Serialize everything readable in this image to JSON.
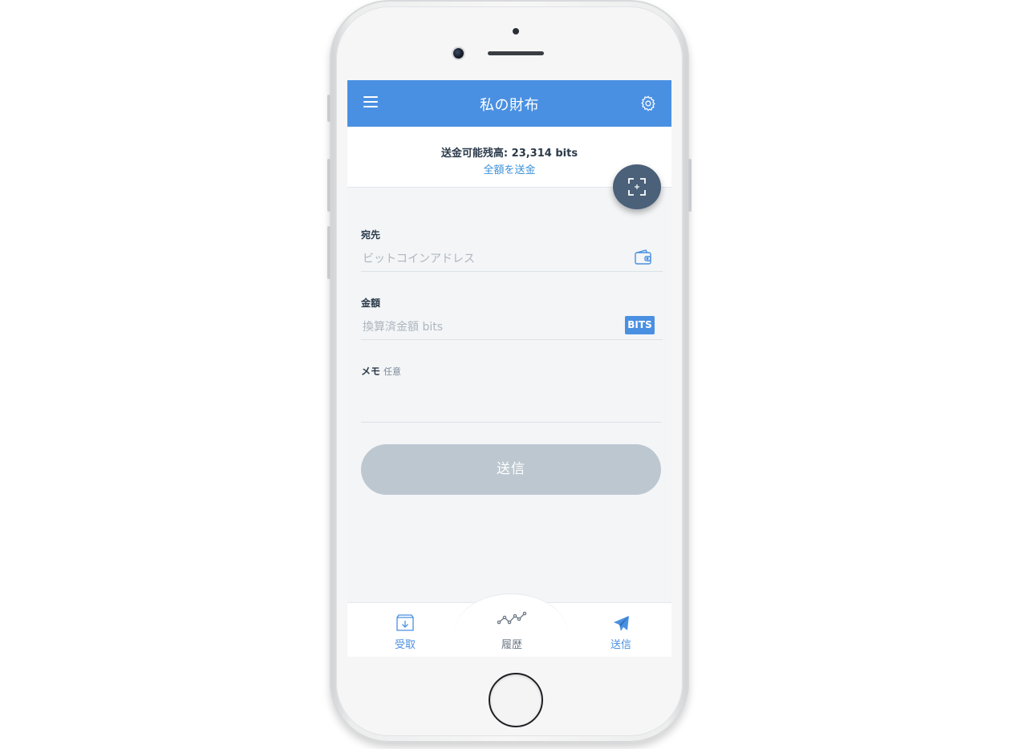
{
  "header": {
    "title": "私の財布"
  },
  "balance": {
    "text": "送金可能残高: 23,314 bits",
    "send_all_link": "全額を送金"
  },
  "form": {
    "recipient_label": "宛先",
    "recipient_placeholder": "ビットコインアドレス",
    "amount_label": "金額",
    "amount_placeholder": "換算済金額 bits",
    "unit": "BITS",
    "memo_label": "メモ",
    "memo_optional": "任意",
    "send_button": "送信"
  },
  "tabs": [
    {
      "label": "受取",
      "icon": "inbox-download-icon"
    },
    {
      "label": "履歴",
      "icon": "chart-line-icon"
    },
    {
      "label": "送信",
      "icon": "paper-plane-icon"
    }
  ],
  "colors": {
    "primary": "#4a90e2",
    "fab": "#4b6079",
    "disabled_button": "#bdc7d0",
    "background": "#f3f5f7"
  }
}
